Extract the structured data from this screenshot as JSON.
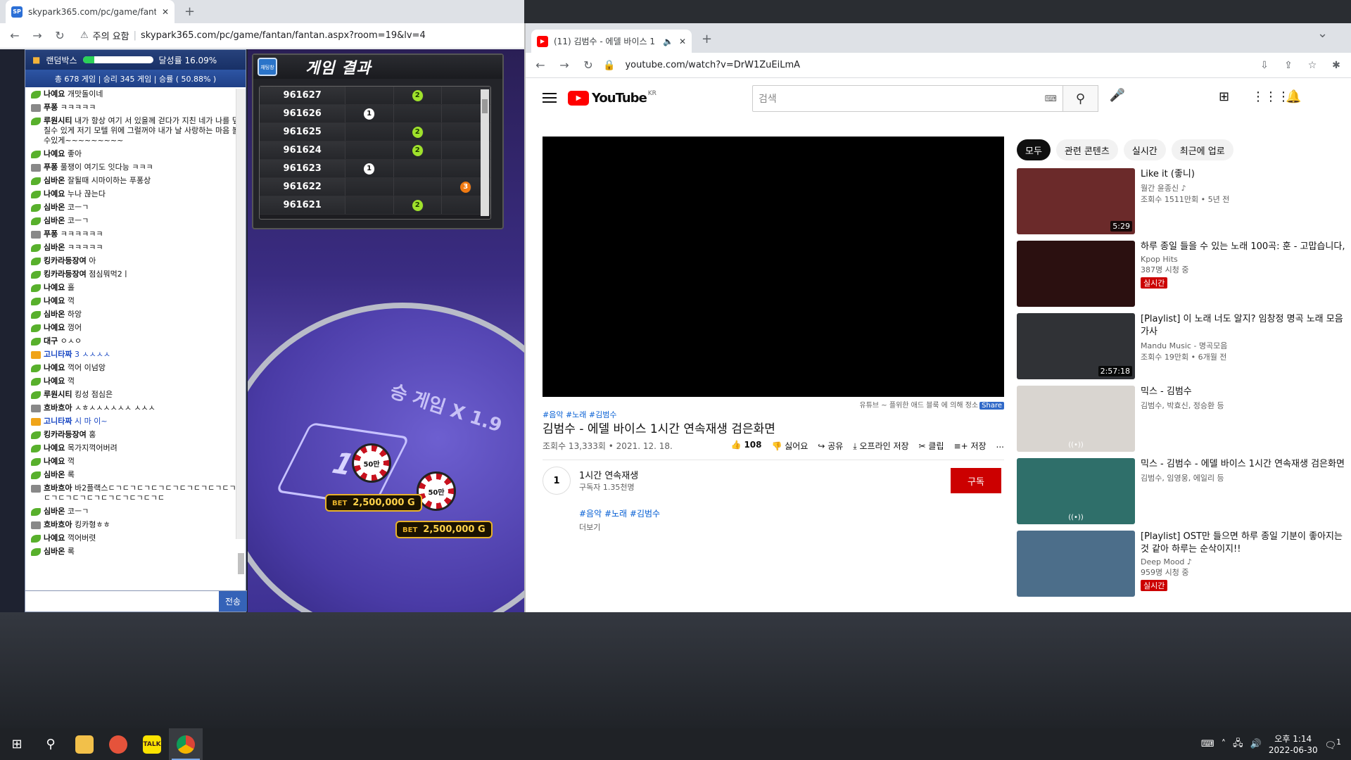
{
  "left_browser": {
    "tab_title": "skypark365.com/pc/game/fantan",
    "favicon": "SP",
    "security_label": "주의 요함",
    "url": "skypark365.com/pc/game/fantan/fantan.aspx?room=19&lv=4"
  },
  "game": {
    "randombox_label": "랜덤박스",
    "progress_percent": 16.09,
    "progress_label": "달성률 16.09%",
    "stats_text": "총 678 게임 | 승리 345 게임 | 승률 ( 50.88% )",
    "results_title": "게임 결과",
    "results_badge": "채팅창",
    "results": [
      {
        "id": "961627",
        "col": 2,
        "mark": "2"
      },
      {
        "id": "961626",
        "col": 1,
        "mark": "1"
      },
      {
        "id": "961625",
        "col": 2,
        "mark": "2"
      },
      {
        "id": "961624",
        "col": 2,
        "mark": "2"
      },
      {
        "id": "961623",
        "col": 1,
        "mark": "1"
      },
      {
        "id": "961622",
        "col": 3,
        "mark": "3"
      },
      {
        "id": "961621",
        "col": 2,
        "mark": "2"
      }
    ],
    "table_label": "승 게임 X 1.9",
    "zone_number": "1",
    "chip_label": "50만",
    "bets": [
      {
        "label": "BET",
        "amount": "2,500,000 G"
      },
      {
        "label": "BET",
        "amount": "2,500,000 G"
      }
    ],
    "send_label": "전송"
  },
  "chat": [
    {
      "icon": "leaf",
      "name": "나예요",
      "text": "개맛돌이네"
    },
    {
      "icon": "grey",
      "name": "푸퐁",
      "text": "ㅋㅋㅋㅋㅋ"
    },
    {
      "icon": "leaf",
      "name": "루원시티",
      "text": "내가 항상 여기 서 있을께 걷다가 지친 네가 나를 덮칠수 있게 저기 모텔 위에 그럴꺼야 내가 날 사랑하는 마음 볼 수있게~~~~~~~~~"
    },
    {
      "icon": "leaf",
      "name": "나예요",
      "text": "좋아"
    },
    {
      "icon": "grey",
      "name": "푸퐁",
      "text": "풀쟁이 여기도 잇다능 ㅋㅋㅋ"
    },
    {
      "icon": "leaf",
      "name": "심바온",
      "text": "잘될때 시마이하는 푸퐁상"
    },
    {
      "icon": "leaf",
      "name": "나예요",
      "text": "누나 끊는다"
    },
    {
      "icon": "leaf",
      "name": "심바온",
      "text": "코ㅡㄱ"
    },
    {
      "icon": "leaf",
      "name": "심바온",
      "text": "코ㅡㄱ"
    },
    {
      "icon": "grey",
      "name": "푸퐁",
      "text": "ㅋㅋㅋㅋㅋㅋ"
    },
    {
      "icon": "leaf",
      "name": "심바온",
      "text": "ㅋㅋㅋㅋㅋ"
    },
    {
      "icon": "leaf",
      "name": "킹카라등장여",
      "text": "아"
    },
    {
      "icon": "leaf",
      "name": "킹카라등장여",
      "text": "점심뭐먹2ㅣ"
    },
    {
      "icon": "leaf",
      "name": "나예요",
      "text": "홀"
    },
    {
      "icon": "leaf",
      "name": "나예요",
      "text": "꺽"
    },
    {
      "icon": "leaf",
      "name": "심바온",
      "text": "하앙"
    },
    {
      "icon": "leaf",
      "name": "나예요",
      "text": "껑어"
    },
    {
      "icon": "leaf",
      "name": "대구",
      "text": "ㅇㅅㅇ"
    },
    {
      "icon": "gold",
      "name": "고니타짜",
      "text": "3 ㅅㅅㅅㅅ",
      "admin": true
    },
    {
      "icon": "leaf",
      "name": "나예요",
      "text": "꺽어 이넘앙"
    },
    {
      "icon": "leaf",
      "name": "나예요",
      "text": "꺽"
    },
    {
      "icon": "leaf",
      "name": "루원시티",
      "text": "킹성 점심은"
    },
    {
      "icon": "grey",
      "name": "흐바흐아",
      "text": "ㅅㅎㅅㅅㅅㅅㅅㅅ ㅅㅅㅅ"
    },
    {
      "icon": "gold",
      "name": "고니타짜",
      "text": "시 마 이~",
      "admin": true
    },
    {
      "icon": "leaf",
      "name": "킹카라등장여",
      "text": "홍"
    },
    {
      "icon": "leaf",
      "name": "나예요",
      "text": "목가지꺽어버려"
    },
    {
      "icon": "leaf",
      "name": "나예요",
      "text": "꺽"
    },
    {
      "icon": "leaf",
      "name": "심바온",
      "text": "록"
    },
    {
      "icon": "grey",
      "name": "흐바흐아",
      "text": "바2플랙스ㄷㄱㄷㄱㄷㄱㄷㄱㄷㄱㄷㄱㄷㄱㄷㄱㄷㄱㄷㄱㄷㄱㄷㄱㄷㄱㄷㄱㄷㄱㄷㄱㄷㄱㄷ"
    },
    {
      "icon": "leaf",
      "name": "심바온",
      "text": "코ㅡㄱ"
    },
    {
      "icon": "grey",
      "name": "흐바흐아",
      "text": "킹카형ㅎㅎ"
    },
    {
      "icon": "leaf",
      "name": "나예요",
      "text": "꺽어버렷"
    },
    {
      "icon": "leaf",
      "name": "심바온",
      "text": "록"
    }
  ],
  "right_browser": {
    "tab_title": "(11) 김범수 - 에델 바이스 1",
    "url": "youtube.com/watch?v=DrW1ZuEiLmA"
  },
  "youtube": {
    "logo": "YouTube",
    "region": "KR",
    "search_placeholder": "검색",
    "ad_note": "유튜브 ~ 플위한 애드 블룩 에 의해 정소",
    "ad_share": "Share",
    "tags": "#음악 #노래 #김범수",
    "title": "김범수 - 에델 바이스 1시간 연속재생 검은화면",
    "views_date": "조회수 13,333회 • 2021. 12. 18.",
    "actions": {
      "like": "108",
      "dislike": "싫어요",
      "share": "공유",
      "offline": "오프라인 저장",
      "clip": "클립",
      "save": "저장",
      "more": "..."
    },
    "channel": {
      "avatar": "1",
      "name": "1시간 연속재생",
      "subs": "구독자 1.35천명",
      "subscribe": "구독"
    },
    "desc_tags": "#음악 #노래 #김범수",
    "more_label": "더보기",
    "chips": [
      "모두",
      "관련 콘텐츠",
      "실시간",
      "최근에 업로"
    ],
    "recs": [
      {
        "title": "Like it (좋니)",
        "channel": "월간 윤종신 ♪",
        "views": "조회수 1511만회 • 5년 전",
        "duration": "5:29",
        "live": false,
        "thumb": "#6b2a2a"
      },
      {
        "title": "하루 종일 들을 수 있는 노래 100곡: 훈 - 고맙습니다,",
        "channel": "Kpop Hits",
        "views": "387명 시청 중",
        "duration": "",
        "live": true,
        "thumb": "#2b1010"
      },
      {
        "title": "[Playlist] 이 노래 너도 알지? 임창정 명곡 노래 모음 가사",
        "channel": "Mandu Music - 명곡모음",
        "views": "조회수 19만회 • 6개월 전",
        "duration": "2:57:18",
        "live": false,
        "thumb": "#303236"
      },
      {
        "title": "믹스 - 김범수",
        "channel": "김범수, 박효신, 정승환 등",
        "views": "",
        "duration": "",
        "live": false,
        "thumb": "#d9d5d0",
        "mix": true
      },
      {
        "title": "믹스 - 김범수 - 에델 바이스 1시간 연속재생 검은화면",
        "channel": "김범수, 임영웅, 에일리 등",
        "views": "",
        "duration": "",
        "live": false,
        "thumb": "#2f6f6a",
        "mix": true
      },
      {
        "title": "[Playlist] OST만 들으면 하루 종일 기분이 좋아지는 것 같아 하루는 순삭이지!!",
        "channel": "Deep Mood ♪",
        "views": "959명 시청 중",
        "duration": "",
        "live": true,
        "thumb": "#4c6e8a"
      }
    ],
    "live_label": "실시간"
  },
  "taskbar": {
    "clock_time": "오후 1:14",
    "clock_date": "2022-06-30",
    "notif_count": "1"
  }
}
